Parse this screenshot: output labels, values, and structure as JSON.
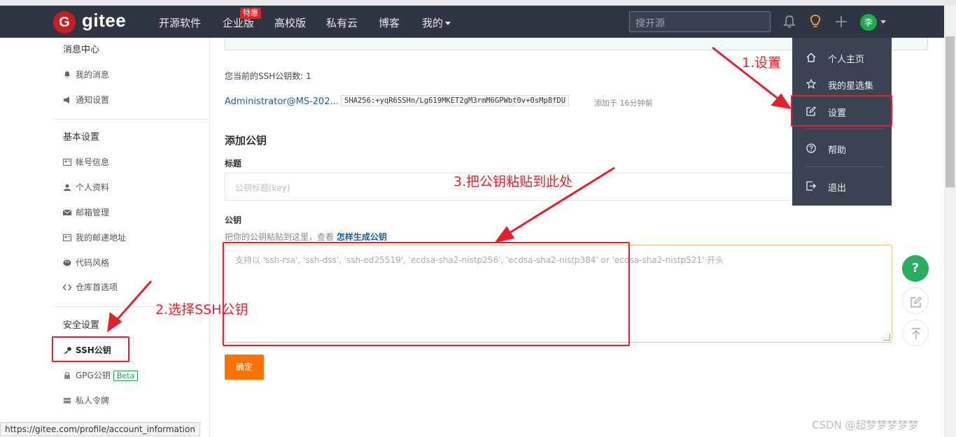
{
  "navbar": {
    "logo_letter": "G",
    "logo_text": "gitee",
    "items": [
      {
        "label": "开源软件"
      },
      {
        "label": "企业版"
      },
      {
        "label": "高校版"
      },
      {
        "label": "私有云"
      },
      {
        "label": "博客"
      },
      {
        "label": "我的"
      }
    ],
    "hot_badge": "特惠",
    "search_placeholder": "搜开源",
    "avatar_text": "李"
  },
  "sidebar": {
    "groups": [
      {
        "title": "消息中心",
        "items": [
          {
            "label": "我的消息"
          },
          {
            "label": "通知设置"
          }
        ]
      },
      {
        "title": "基本设置",
        "items": [
          {
            "label": "帐号信息"
          },
          {
            "label": "个人资料"
          },
          {
            "label": "邮箱管理"
          },
          {
            "label": "我的邮递地址"
          },
          {
            "label": "代码风格"
          },
          {
            "label": "仓库首选项"
          }
        ]
      },
      {
        "title": "安全设置",
        "items": [
          {
            "label": "SSH公钥"
          },
          {
            "label": "GPG公钥",
            "badge": "Beta"
          },
          {
            "label": "私人令牌"
          }
        ]
      }
    ]
  },
  "main": {
    "key_count_label": "您当前的SSH公钥数: 1",
    "key": {
      "name": "Administrator@MS-202...",
      "fingerprint": "SHA256:+yqR6SSHn/Lg619MKET2gM3rmM6GPWbt0v+0sMp8fDU",
      "added": "添加于 16分钟前"
    },
    "add_title": "添加公钥",
    "title_label": "标题",
    "title_placeholder": "公钥标题(key)",
    "key_label": "公钥",
    "key_hint": "把你的公钥粘贴到这里，查看",
    "key_hint_link": "怎样生成公钥",
    "key_placeholder": "支持以 'ssh-rsa', 'ssh-dss', 'ssh-ed25519', 'ecdsa-sha2-nistp256', 'ecdsa-sha2-nistp384' or 'ecdsa-sha2-nistp521' 开头",
    "submit_label": "确定"
  },
  "dropdown": {
    "items": [
      {
        "label": "个人主页",
        "icon": "home-icon"
      },
      {
        "label": "我的星选集",
        "icon": "star-icon"
      },
      {
        "label": "设置",
        "icon": "edit-icon"
      },
      {
        "label": "帮助",
        "icon": "help-icon"
      },
      {
        "label": "退出",
        "icon": "logout-icon"
      }
    ]
  },
  "floating": {
    "help_label": "?"
  },
  "annotations": {
    "step1": "1.设置",
    "step2": "2.选择SSH公钥",
    "step3": "3.把公钥粘贴到此处",
    "color": "#e3202d"
  },
  "status_url": "https://gitee.com/profile/account_information",
  "watermark": "CSDN @超梦梦梦梦梦"
}
